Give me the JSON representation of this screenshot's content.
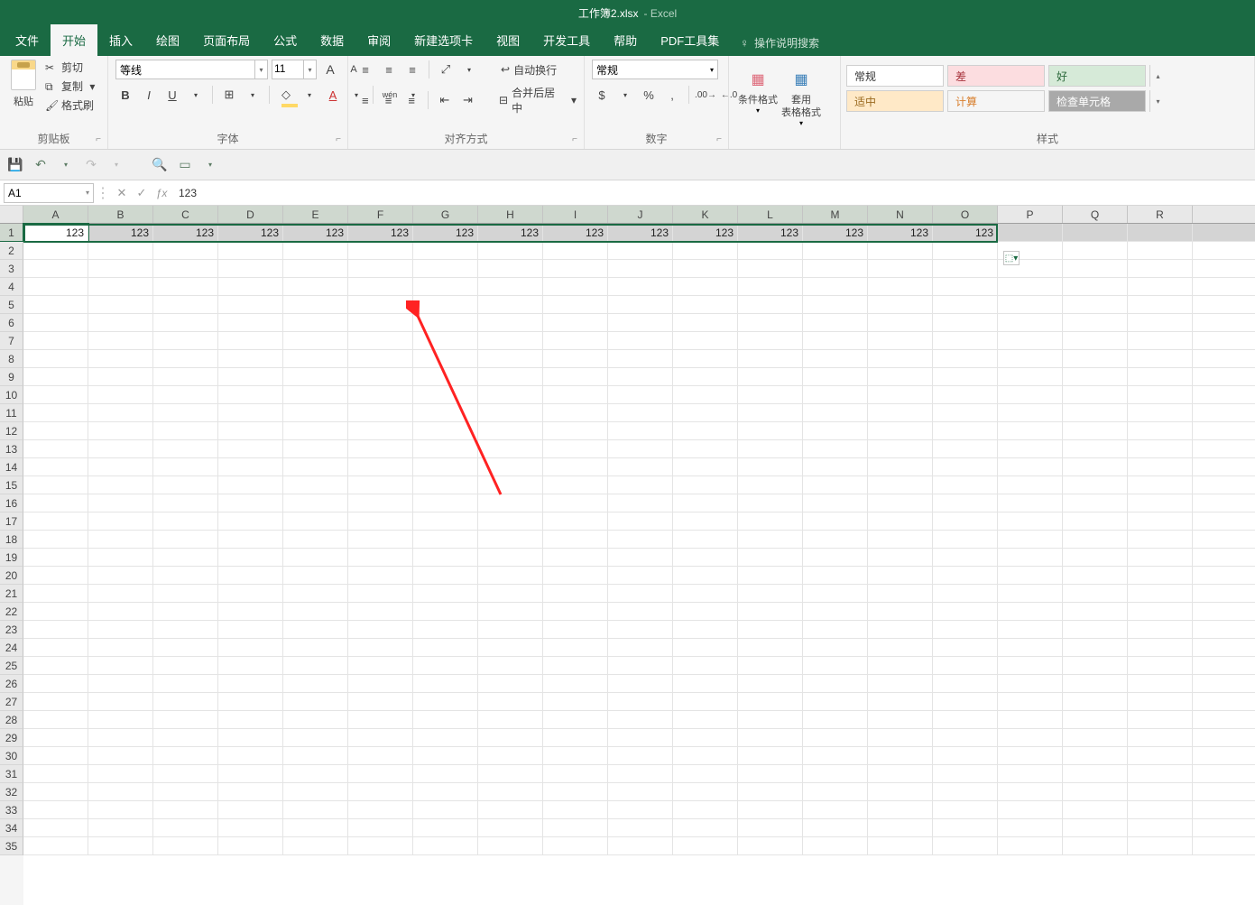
{
  "title": {
    "doc": "工作簿2.xlsx",
    "app": "Excel"
  },
  "menu": {
    "tabs": [
      "文件",
      "开始",
      "插入",
      "绘图",
      "页面布局",
      "公式",
      "数据",
      "审阅",
      "新建选项卡",
      "视图",
      "开发工具",
      "帮助",
      "PDF工具集"
    ],
    "active_index": 1,
    "tellme": "操作说明搜索"
  },
  "ribbon": {
    "clipboard": {
      "label": "剪贴板",
      "paste": "粘贴",
      "cut": "剪切",
      "copy": "复制",
      "format_painter": "格式刷"
    },
    "font": {
      "label": "字体",
      "name": "等线",
      "size": "11",
      "bold": "B",
      "italic": "I",
      "underline": "U",
      "grow": "A",
      "shrink": "A"
    },
    "alignment": {
      "label": "对齐方式",
      "wrap": "自动换行",
      "merge": "合并后居中"
    },
    "number": {
      "label": "数字",
      "format": "常规"
    },
    "styles": {
      "label": "样式",
      "cond_fmt": "条件格式",
      "table_fmt": "套用\n表格格式",
      "normal": "常规",
      "bad": "差",
      "good": "好",
      "neutral": "适中",
      "calc": "计算",
      "check": "检查单元格"
    }
  },
  "formula_bar": {
    "name_box": "A1",
    "value": "123"
  },
  "sheet": {
    "columns": [
      "A",
      "B",
      "C",
      "D",
      "E",
      "F",
      "G",
      "H",
      "I",
      "J",
      "K",
      "L",
      "M",
      "N",
      "O",
      "P",
      "Q",
      "R"
    ],
    "rows_count": 35,
    "row1_values": [
      "123",
      "123",
      "123",
      "123",
      "123",
      "123",
      "123",
      "123",
      "123",
      "123",
      "123",
      "123",
      "123",
      "123",
      "123",
      "",
      "",
      ""
    ]
  }
}
